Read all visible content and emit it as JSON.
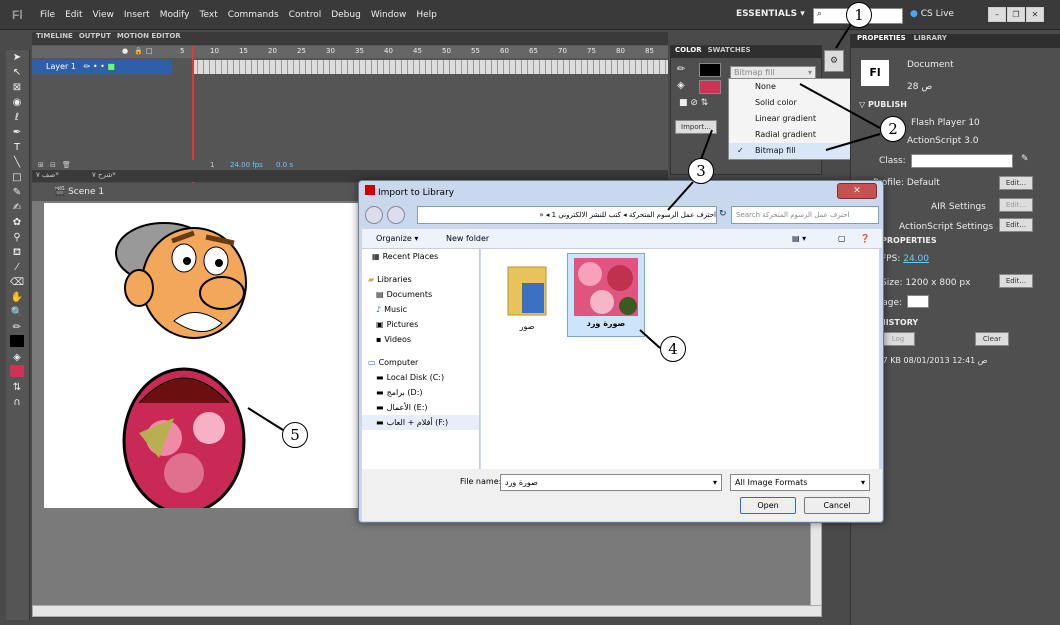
{
  "app": {
    "logo": "Fl",
    "menus": [
      "File",
      "Edit",
      "View",
      "Insert",
      "Modify",
      "Text",
      "Commands",
      "Control",
      "Debug",
      "Window",
      "Help"
    ],
    "workspace": "ESSENTIALS",
    "cs_live": "CS Live"
  },
  "timeline": {
    "tabs": [
      "TIMELINE",
      "OUTPUT",
      "MOTION EDITOR"
    ],
    "ticks": [
      "5",
      "10",
      "15",
      "20",
      "25",
      "30",
      "35",
      "40",
      "45",
      "50",
      "55",
      "60",
      "65",
      "70",
      "75",
      "80",
      "85"
    ],
    "layer": "Layer 1",
    "frame": "1",
    "fps": "24.00 fps",
    "time": "0.0 s",
    "doc_tabs": [
      "صف ٧*",
      "شرح ٧*"
    ]
  },
  "scene": {
    "name": "Scene 1"
  },
  "color_panel": {
    "tabs": [
      "COLOR",
      "SWATCHES"
    ],
    "fill_type": "Bitmap fill",
    "import_label": "Import...",
    "fill_options": [
      "None",
      "Solid color",
      "Linear gradient",
      "Radial gradient",
      "Bitmap fill"
    ],
    "selected": "Bitmap fill"
  },
  "properties": {
    "tabs": [
      "PROPERTIES",
      "LIBRARY"
    ],
    "doc_label": "Document",
    "doc_icon": "Fl",
    "doc_name": "ص 28",
    "publish": "PUBLISH",
    "player": "Flash Player 10",
    "script": "ActionScript 3.0",
    "class_label": "Class:",
    "profile": "Profile: Default",
    "edit": "Edit...",
    "air": "AIR Settings",
    "as_settings": "ActionScript Settings",
    "props_head": "PROPERTIES",
    "fps_label": "FPS:",
    "fps": "24.00",
    "size_label": "Size:",
    "size": "1200 x 800 px",
    "stage_label": "Stage:",
    "history": "HISTORY",
    "log": "Log",
    "clear": "Clear",
    "history_entry": "1.7 KB  08/01/2013  12:41 ص"
  },
  "dialog": {
    "title": "Import to Library",
    "path": "احترف عمل الرسوم المتحركة ◂ كتب للنشر الالكتروني 1 ◂ «",
    "search": "Search احترف عمل الرسوم المتحركة",
    "organize": "Organize ▾",
    "new_folder": "New folder",
    "nav": [
      "Recent Places",
      "Libraries",
      "Documents",
      "Music",
      "Pictures",
      "Videos",
      "Computer",
      "Local Disk (C:)",
      "برامج (D:)",
      "الأعمال (E:)",
      "أفلام + العاب (F:)"
    ],
    "files": [
      "صور",
      "صورة ورد"
    ],
    "filename_label": "File name:",
    "filename": "صورة ورد",
    "filter": "All Image Formats",
    "open": "Open",
    "cancel": "Cancel"
  },
  "callouts": [
    "1",
    "2",
    "3",
    "4",
    "5"
  ]
}
